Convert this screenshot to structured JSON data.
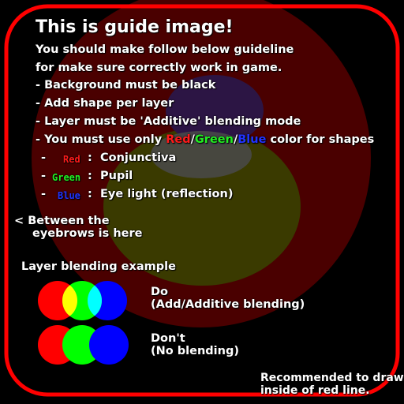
{
  "title": "This is guide image!",
  "intro": {
    "line1": "You should make follow below guideline",
    "line2": "for make sure correctly work in game."
  },
  "rules": {
    "background": "- Background must be black",
    "add_shape": "- Add shape per layer",
    "blending": "- Layer must be 'Additive' blending mode",
    "color_prefix": "- You must use only ",
    "color_red": "Red",
    "sep1": "/",
    "color_green": "Green",
    "sep2": "/",
    "color_blue": "Blue",
    "color_suffix": " color for shapes"
  },
  "legend": [
    {
      "dash": "-",
      "key": "Red",
      "colon": ":",
      "value": "Conjunctiva",
      "color": "#ff1a1a"
    },
    {
      "dash": "-",
      "key": "Green",
      "colon": ":",
      "value": "Pupil",
      "color": "#22ee22"
    },
    {
      "dash": "-",
      "key": "Blue",
      "colon": ":",
      "value": "Eye light (reflection)",
      "color": "#2233ff"
    }
  ],
  "eyebrows_note": {
    "line1": "< Between the",
    "line2": "eyebrows is here"
  },
  "blending_example": {
    "title": "Layer blending example",
    "do": {
      "line1": "Do",
      "line2": "(Add/Additive blending)"
    },
    "dont": {
      "line1": "Don't",
      "line2": "(No blending)"
    }
  },
  "recommend": {
    "line1": "Recommended to draw",
    "line2": "inside of red line."
  },
  "colors": {
    "background": "#000000",
    "guide_line": "#ff0000",
    "conjunctiva": "#4a0000",
    "pupil": "#3a3a00",
    "eye_light": "#2a0040",
    "circle_red": "#ff0000",
    "circle_green": "#00ff00",
    "circle_blue": "#0000ff",
    "overlap_red_green": "#ffff00",
    "overlap_green_blue": "#00ffff"
  }
}
